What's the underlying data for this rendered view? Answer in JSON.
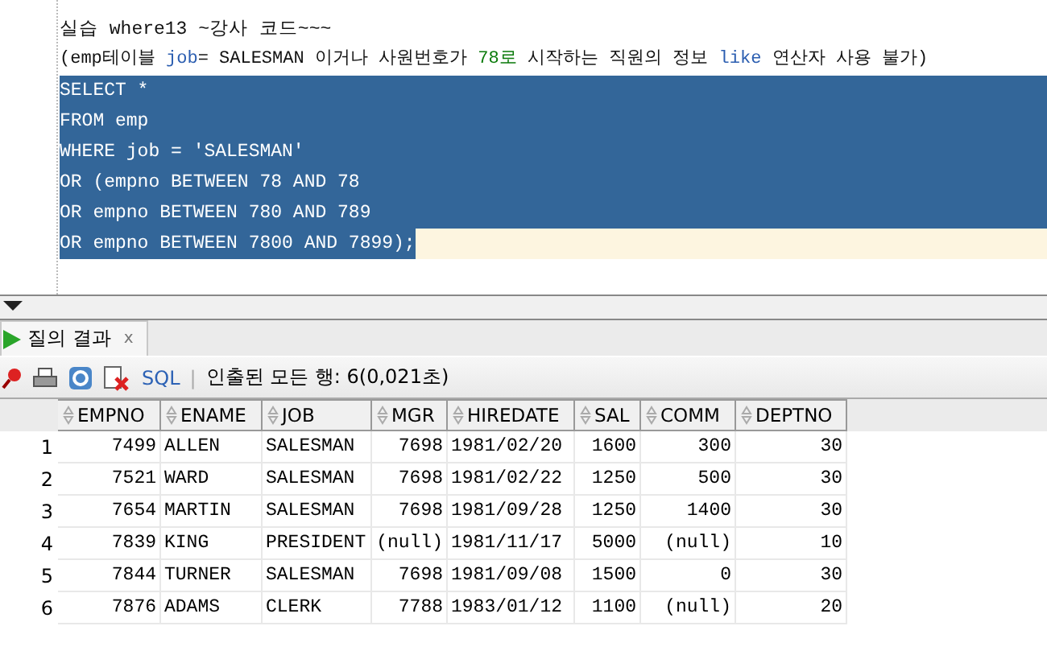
{
  "editor": {
    "lines": [
      {
        "selected": false,
        "current": false,
        "segments": [
          {
            "text": "실습 where13 ~강사 코드~~~",
            "kind": "plain"
          }
        ]
      },
      {
        "selected": false,
        "current": false,
        "segments": [
          {
            "text": "(emp테이블 ",
            "kind": "plain"
          },
          {
            "text": "job",
            "kind": "keyword"
          },
          {
            "text": "= SALESMAN 이거나 사원번호가 ",
            "kind": "plain"
          },
          {
            "text": "78로",
            "kind": "number"
          },
          {
            "text": " 시작하는 직원의 정보 ",
            "kind": "plain"
          },
          {
            "text": "like",
            "kind": "keyword"
          },
          {
            "text": " 연산자 사용 불가)",
            "kind": "plain"
          }
        ]
      },
      {
        "selected": true,
        "current": false,
        "segments": [
          {
            "text": "SELECT *",
            "kind": "plain"
          }
        ]
      },
      {
        "selected": true,
        "current": false,
        "segments": [
          {
            "text": "FROM emp",
            "kind": "plain"
          }
        ]
      },
      {
        "selected": true,
        "current": false,
        "segments": [
          {
            "text": "WHERE job = 'SALESMAN'",
            "kind": "plain"
          }
        ]
      },
      {
        "selected": true,
        "current": false,
        "segments": [
          {
            "text": "OR (empno BETWEEN 78 AND 78",
            "kind": "plain"
          }
        ]
      },
      {
        "selected": true,
        "current": false,
        "segments": [
          {
            "text": "OR empno BETWEEN 780 AND 789",
            "kind": "plain"
          }
        ]
      },
      {
        "selected": true,
        "current": true,
        "segments": [
          {
            "text": "OR empno BETWEEN 7800 AND 7899);",
            "kind": "plain"
          }
        ]
      }
    ]
  },
  "results_panel": {
    "tabs": [
      {
        "label": "질의 결과",
        "close": "x",
        "selected": true
      }
    ],
    "toolbar": {
      "sql_link": "SQL",
      "separator": "|",
      "status": "인출된 모든 행: 6(0,021초)"
    },
    "table": {
      "columns": [
        "EMPNO",
        "ENAME",
        "JOB",
        "MGR",
        "HIREDATE",
        "SAL",
        "COMM",
        "DEPTNO"
      ],
      "rows": [
        {
          "number": "1",
          "cells": [
            "7499",
            "ALLEN",
            "SALESMAN",
            "7698",
            "1981/02/20",
            "1600",
            "300",
            "30"
          ]
        },
        {
          "number": "2",
          "cells": [
            "7521",
            "WARD",
            "SALESMAN",
            "7698",
            "1981/02/22",
            "1250",
            "500",
            "30"
          ]
        },
        {
          "number": "3",
          "cells": [
            "7654",
            "MARTIN",
            "SALESMAN",
            "7698",
            "1981/09/28",
            "1250",
            "1400",
            "30"
          ]
        },
        {
          "number": "4",
          "cells": [
            "7839",
            "KING",
            "PRESIDENT",
            "(null)",
            "1981/11/17",
            "5000",
            "(null)",
            "10"
          ]
        },
        {
          "number": "5",
          "cells": [
            "7844",
            "TURNER",
            "SALESMAN",
            "7698",
            "1981/09/08",
            "1500",
            "0",
            "30"
          ]
        },
        {
          "number": "6",
          "cells": [
            "7876",
            "ADAMS",
            "CLERK",
            "7788",
            "1983/01/12",
            "1100",
            "(null)",
            "20"
          ]
        }
      ]
    }
  }
}
